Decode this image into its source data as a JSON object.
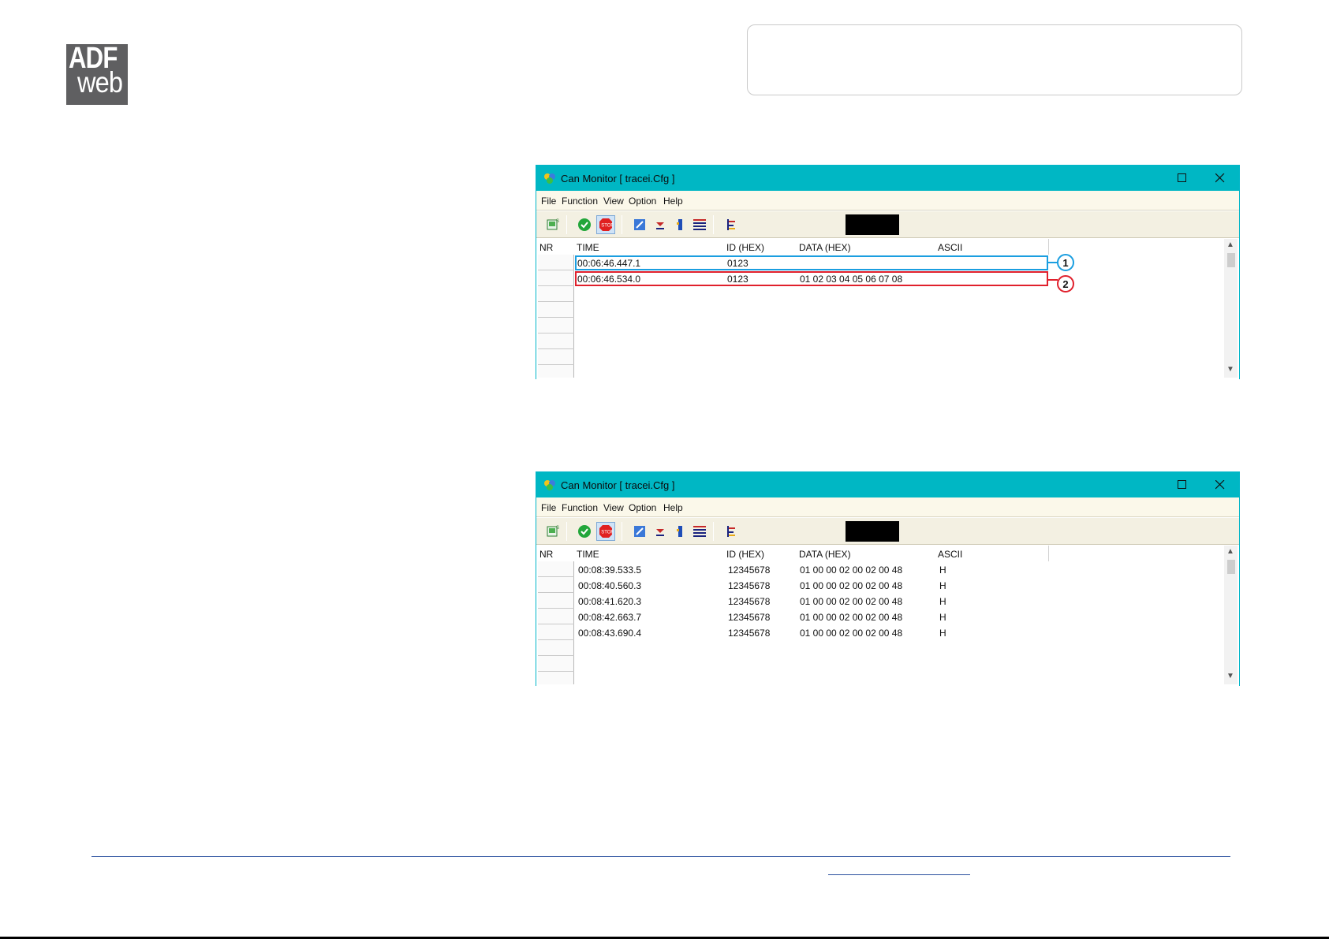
{
  "logo": {
    "line1": "ADF",
    "line2": "web"
  },
  "window_title": "Can Monitor [ tracei.Cfg ]",
  "menu": [
    "File",
    "Function",
    "View",
    "Option",
    "Help"
  ],
  "columns": {
    "nr": "NR",
    "time": "TIME",
    "id": "ID (HEX)",
    "data": "DATA (HEX)",
    "ascii": "ASCII"
  },
  "window1": {
    "rows": [
      {
        "time": "00:06:46.447.1",
        "id": "0123",
        "data": "",
        "ascii": ""
      },
      {
        "time": "00:06:46.534.0",
        "id": "0123",
        "data": "01 02 03 04 05 06 07 08",
        "ascii": ""
      }
    ],
    "callouts": [
      {
        "label": "1",
        "color": "#1a9ee0"
      },
      {
        "label": "2",
        "color": "#e0202c"
      }
    ]
  },
  "window2": {
    "rows": [
      {
        "time": "00:08:39.533.5",
        "id": "12345678",
        "data": "01 00 00 02 00 02 00 48",
        "ascii": "H"
      },
      {
        "time": "00:08:40.560.3",
        "id": "12345678",
        "data": "01 00 00 02 00 02 00 48",
        "ascii": "H"
      },
      {
        "time": "00:08:41.620.3",
        "id": "12345678",
        "data": "01 00 00 02 00 02 00 48",
        "ascii": "H"
      },
      {
        "time": "00:08:42.663.7",
        "id": "12345678",
        "data": "01 00 00 02 00 02 00 48",
        "ascii": "H"
      },
      {
        "time": "00:08:43.690.4",
        "id": "12345678",
        "data": "01 00 00 02 00 02 00 48",
        "ascii": "H"
      }
    ]
  },
  "icons": {
    "app": "can-monitor-app-icon",
    "toolbar": [
      "open-config-icon",
      "start-check-icon",
      "stop-icon",
      "edit-icon",
      "download-icon",
      "filter-icon",
      "list-icon",
      "tree-icon"
    ]
  },
  "colors": {
    "titlebar": "#00b7c4",
    "menubar": "#fbf8ea",
    "highlight_blue": "#1a9ee0",
    "highlight_red": "#e0202c",
    "footer_line": "#2a4f9e"
  }
}
